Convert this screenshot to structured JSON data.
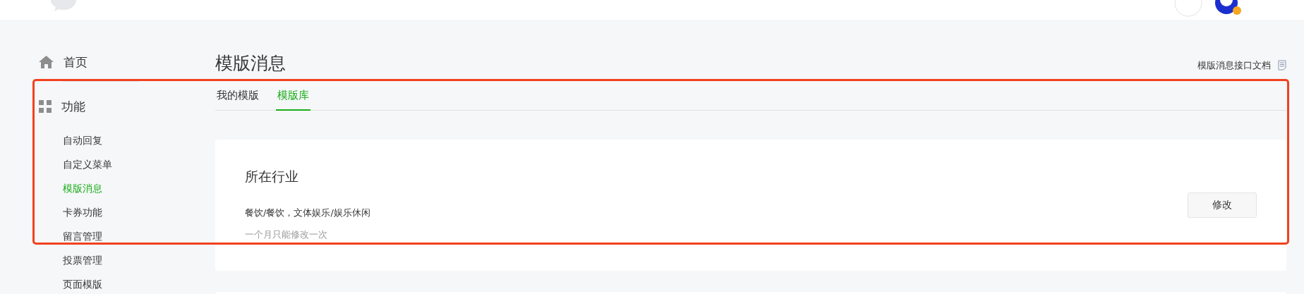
{
  "sidebar": {
    "items": [
      {
        "label": "首页",
        "kind": "home",
        "selected": false
      },
      {
        "label": "功能",
        "kind": "section",
        "selected": false
      },
      {
        "label": "自动回复",
        "kind": "sub",
        "selected": false
      },
      {
        "label": "自定义菜单",
        "kind": "sub",
        "selected": false
      },
      {
        "label": "模版消息",
        "kind": "sub",
        "selected": true
      },
      {
        "label": "卡券功能",
        "kind": "sub",
        "selected": false
      },
      {
        "label": "留言管理",
        "kind": "sub",
        "selected": false
      },
      {
        "label": "投票管理",
        "kind": "sub",
        "selected": false
      },
      {
        "label": "页面模版",
        "kind": "sub",
        "selected": false
      }
    ]
  },
  "page": {
    "title": "模版消息",
    "doc_link": "模版消息接口文档"
  },
  "tabs": [
    {
      "label": "我的模版",
      "selected": false
    },
    {
      "label": "模版库",
      "selected": true
    }
  ],
  "industry_card": {
    "title": "所在行业",
    "value": "餐饮/餐饮，文体娱乐/娱乐休闲",
    "note": "一个月只能修改一次",
    "button": "修改"
  }
}
